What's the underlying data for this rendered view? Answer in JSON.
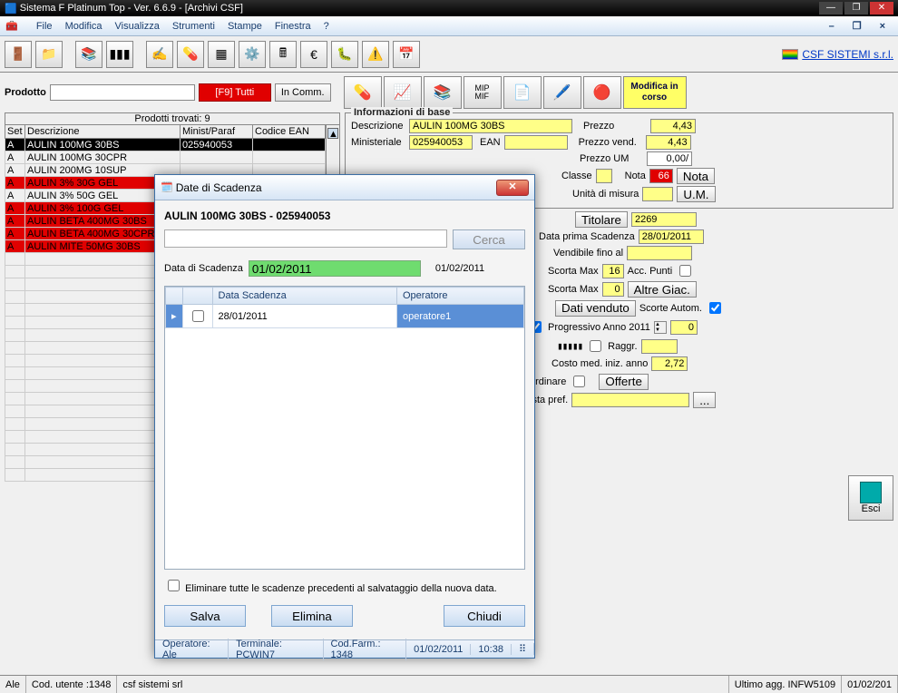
{
  "window": {
    "title": "Sistema F Platinum Top - Ver. 6.6.9 - [Archivi CSF]"
  },
  "menu": {
    "file": "File",
    "modifica": "Modifica",
    "visualizza": "Visualizza",
    "strumenti": "Strumenti",
    "stampe": "Stampe",
    "finestra": "Finestra",
    "help": "?"
  },
  "logo": "CSF SISTEMI s.r.l.",
  "search": {
    "label": "Prodotto",
    "f9": "[F9] Tutti",
    "incomm": "In Comm."
  },
  "mod_badge": "Modifica\nin corso",
  "grid": {
    "found": "Prodotti trovati: 9",
    "cols": {
      "set": "Set",
      "desc": "Descrizione",
      "minist": "Minist/Paraf",
      "ean": "Codice EAN"
    },
    "rows": [
      {
        "set": "A",
        "desc": "AULIN 100MG 30BS",
        "min": "025940053",
        "cls": "sel"
      },
      {
        "set": "A",
        "desc": "AULIN 100MG 30CPR",
        "min": "",
        "cls": ""
      },
      {
        "set": "A",
        "desc": "AULIN 200MG 10SUP",
        "min": "",
        "cls": ""
      },
      {
        "set": "A",
        "desc": "AULIN 3% 30G GEL",
        "min": "",
        "cls": "red"
      },
      {
        "set": "A",
        "desc": "AULIN 3% 50G GEL",
        "min": "",
        "cls": ""
      },
      {
        "set": "A",
        "desc": "AULIN 3% 100G GEL",
        "min": "",
        "cls": "red"
      },
      {
        "set": "A",
        "desc": "AULIN BETA 400MG 30BS",
        "min": "",
        "cls": "red"
      },
      {
        "set": "A",
        "desc": "AULIN BETA 400MG 30CPR",
        "min": "",
        "cls": "red"
      },
      {
        "set": "A",
        "desc": "AULIN MITE 50MG 30BS",
        "min": "",
        "cls": "red"
      }
    ]
  },
  "info": {
    "legend": "Informazioni di base",
    "descr_l": "Descrizione",
    "descr_v": "AULIN 100MG 30BS",
    "minist_l": "Ministeriale",
    "minist_v": "025940053",
    "ean_l": "EAN",
    "prezzo_l": "Prezzo",
    "prezzo_v": "4,43",
    "prezzov_l": "Prezzo vend.",
    "prezzov_v": "4,43",
    "prezzoum_l": "Prezzo UM",
    "prezzoum_v": "0,00/",
    "classe_l": "Classe",
    "nota_l": "Nota",
    "nota_v": "66",
    "nota_btn": "Nota",
    "um_l": "Unità di misura",
    "um_btn": "U.M.",
    "titolare_l": "Titolare",
    "titolare_v": "2269",
    "dps_l": "Data prima Scadenza",
    "dps_v": "28/01/2011",
    "vfa_l": "Vendibile fino al",
    "smax_l": "Scorta Max",
    "smax_v": "16",
    "accp_l": "Acc. Punti",
    "smax2_l": "Scorta Max",
    "smax2_v": "0",
    "altreg_l": "Altre Giac.",
    "dativ_l": "Dati venduto",
    "scaut_l": "Scorte Autom.",
    "prog_l": "Progressivo Anno 2011",
    "prog_v": "0",
    "raggr_l": "Raggr.",
    "costo_l": "Costo med. iniz. anno",
    "costo_v": "2,72",
    "ord_l": "ordinare",
    "off_l": "Offerte",
    "lista_l": "ista pref.",
    "esci": "Esci",
    "peek_val": "0"
  },
  "dialog": {
    "title": "Date di Scadenza",
    "heading": "AULIN 100MG 30BS - 025940053",
    "cerca": "Cerca",
    "dds_l": "Data di Scadenza",
    "dds_v": "01/02/2011",
    "dds_side": "01/02/2011",
    "col1": "Data Scadenza",
    "col2": "Operatore",
    "row_date": "28/01/2011",
    "row_op": "operatore1",
    "chk": "Eliminare tutte le scadenze precedenti al salvataggio della nuova data.",
    "salva": "Salva",
    "elimina": "Elimina",
    "chiudi": "Chiudi",
    "st_op": "Operatore: Ale",
    "st_term": "Terminale: PCWIN7",
    "st_cod": "Cod.Farm.: 1348",
    "st_date": "01/02/2011",
    "st_time": "10:38"
  },
  "status": {
    "ale": "Ale",
    "cod": "Cod. utente :1348",
    "csf": "csf sistemi srl",
    "agg": "Ultimo agg. INFW5109",
    "date": "01/02/201"
  }
}
